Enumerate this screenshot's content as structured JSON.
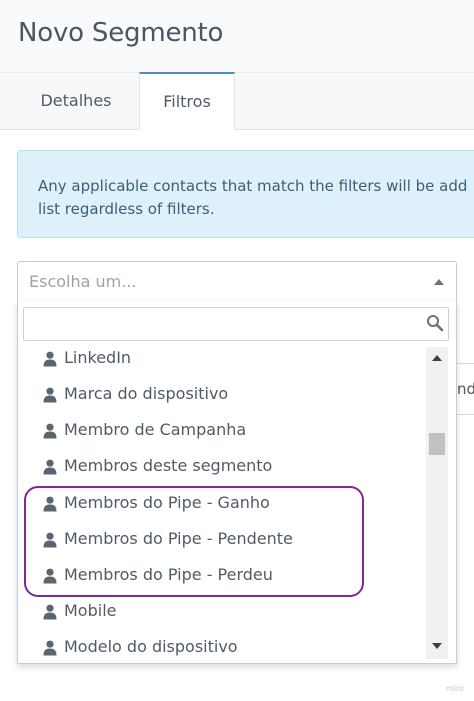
{
  "header": {
    "title": "Novo Segmento"
  },
  "tabs": [
    {
      "label": "Detalhes",
      "active": false
    },
    {
      "label": "Filtros",
      "active": true
    }
  ],
  "info": {
    "line1": "Any applicable contacts that match the filters will be add",
    "line2": "list regardless of filters."
  },
  "select": {
    "placeholder": "Escolha um..."
  },
  "behind_field": {
    "text": "nd"
  },
  "dropdown": {
    "search_placeholder": "",
    "search_icon": "search-icon",
    "item_icon": "user-icon",
    "items": [
      {
        "label": "LinkedIn"
      },
      {
        "label": "Marca do dispositivo"
      },
      {
        "label": "Membro de Campanha"
      },
      {
        "label": "Membros deste segmento"
      },
      {
        "label": "Membros do Pipe - Ganho"
      },
      {
        "label": "Membros do Pipe - Pendente"
      },
      {
        "label": "Membros do Pipe - Perdeu"
      },
      {
        "label": "Mobile"
      },
      {
        "label": "Modelo do dispositivo"
      }
    ]
  },
  "highlight_color": "#7e2a8e",
  "accent_color": "#4e8ec5",
  "watermark": "miro"
}
